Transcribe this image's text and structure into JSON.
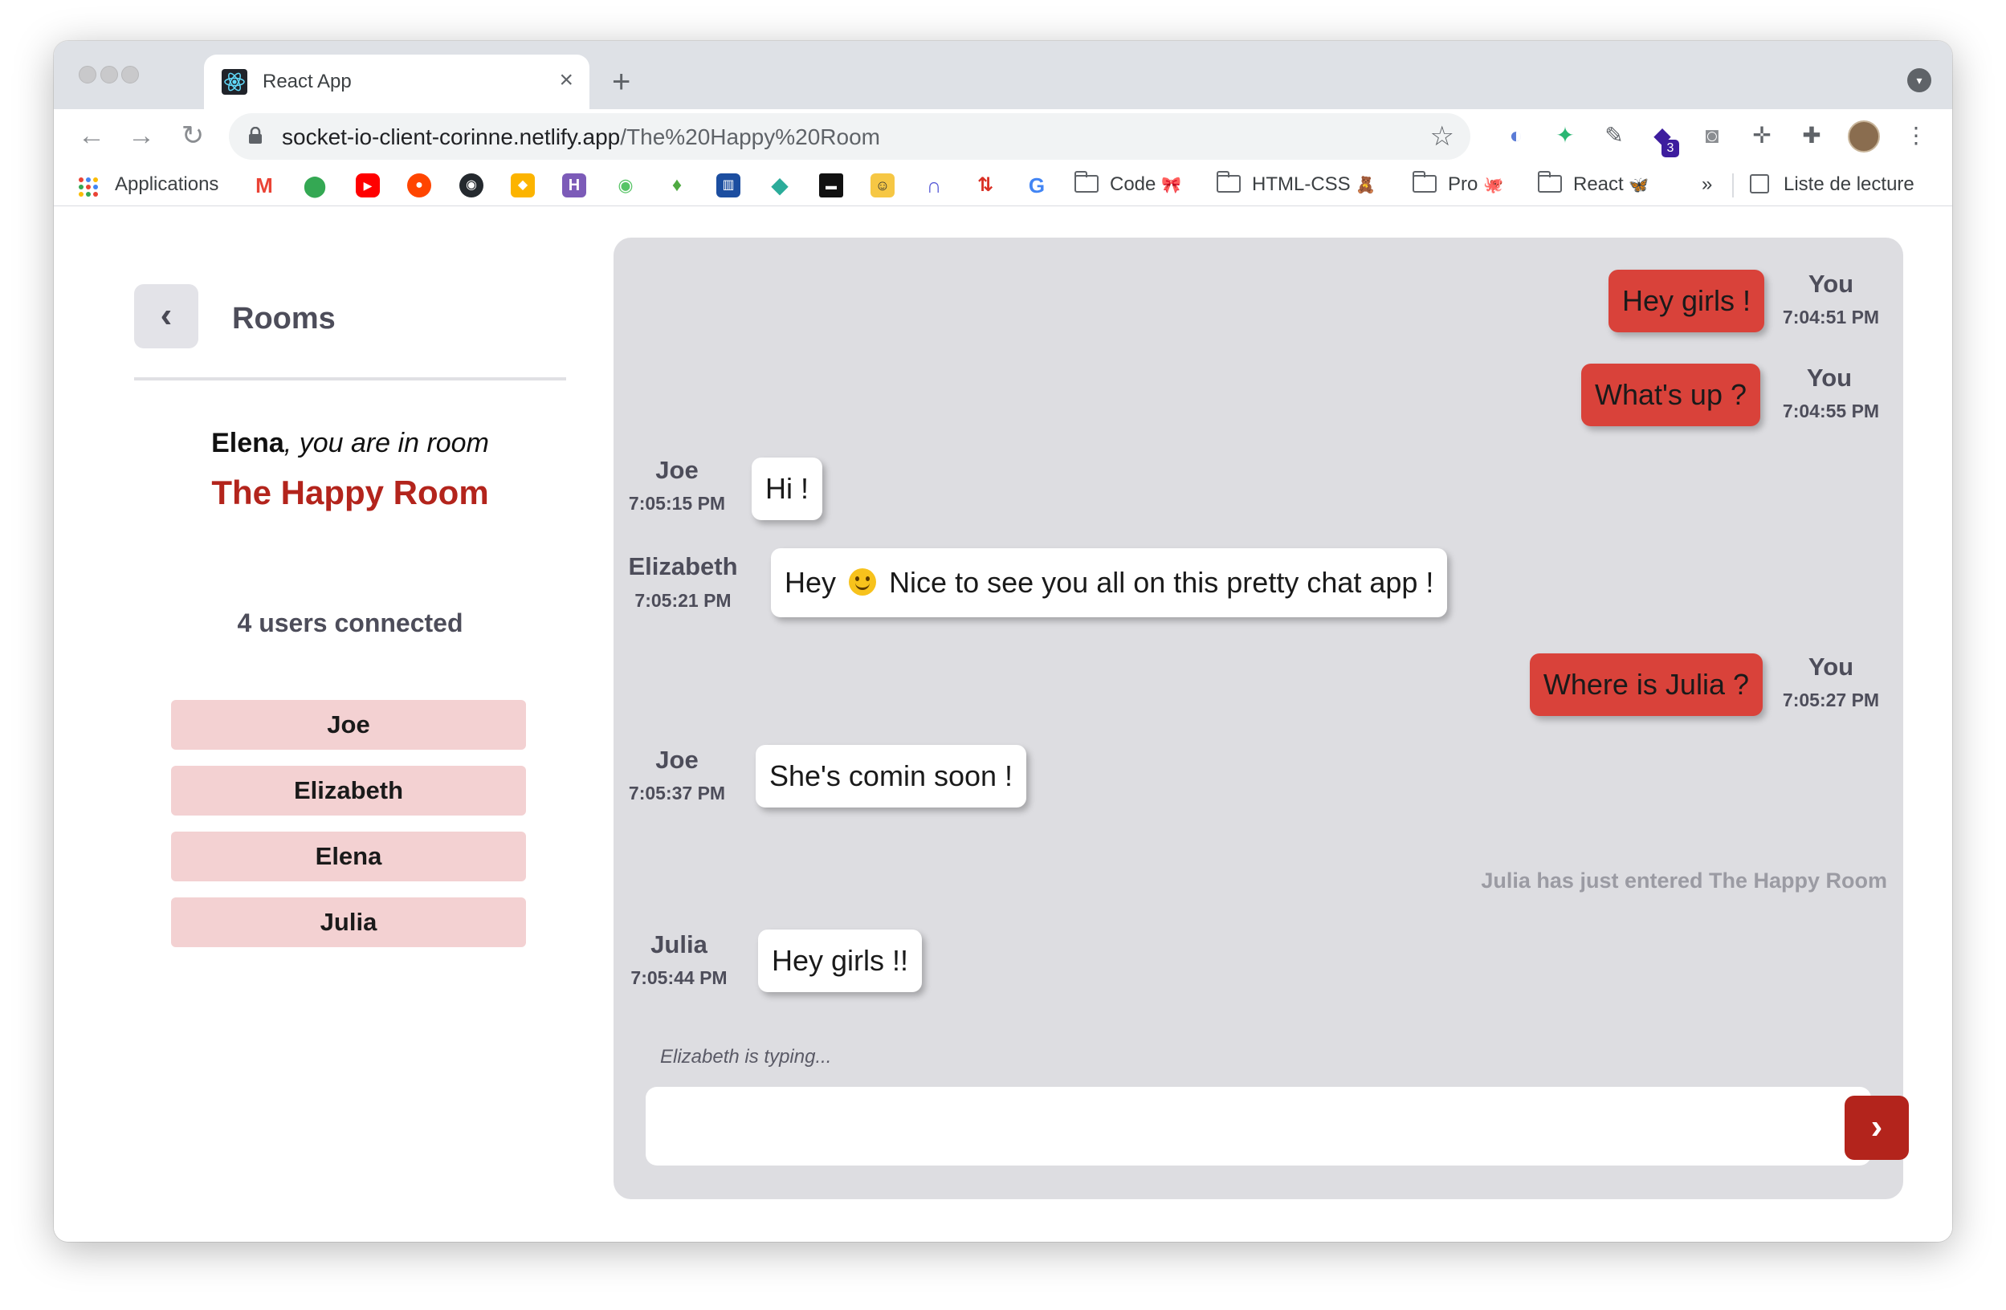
{
  "browser": {
    "tab_title": "React App",
    "tab_close": "×",
    "new_tab": "+",
    "url_host": "socket-io-client-corinne.netlify.app",
    "url_path": "/The%20Happy%20Room",
    "extension_badge": "3"
  },
  "bookmarks": {
    "apps_label": "Applications",
    "items": [
      {
        "label": "Code",
        "emoji": "🎀"
      },
      {
        "label": "HTML-CSS",
        "emoji": "🧸"
      },
      {
        "label": "Pro",
        "emoji": "🐙"
      },
      {
        "label": "React",
        "emoji": "🦋"
      }
    ],
    "overflow": "»",
    "reading_list": "Liste de lecture"
  },
  "sidebar": {
    "back_icon": "‹",
    "title": "Rooms",
    "user_name": "Elena",
    "greeting_suffix": ", you are in room",
    "room_name": "The Happy Room",
    "users_count": "4 users connected",
    "users": [
      "Joe",
      "Elizabeth",
      "Elena",
      "Julia"
    ]
  },
  "chat": {
    "messages": [
      {
        "sender": "You",
        "time": "7:04:51 PM",
        "text": "Hey girls !",
        "mine": true
      },
      {
        "sender": "You",
        "time": "7:04:55 PM",
        "text": "What's up ?",
        "mine": true
      },
      {
        "sender": "Joe",
        "time": "7:05:15 PM",
        "text": "Hi !",
        "mine": false
      },
      {
        "sender": "Elizabeth",
        "time": "7:05:21 PM",
        "text_before": "Hey",
        "text_after": "Nice to see you all on this pretty chat app !",
        "mine": false
      },
      {
        "sender": "You",
        "time": "7:05:27 PM",
        "text": "Where is Julia ?",
        "mine": true
      },
      {
        "sender": "Joe",
        "time": "7:05:37 PM",
        "text": "She's comin soon !",
        "mine": false
      },
      {
        "sender": "Julia",
        "time": "7:05:44 PM",
        "text": "Hey girls !!",
        "mine": false
      }
    ],
    "system_message": "Julia has just entered The Happy Room",
    "typing": "Elizabeth is typing...",
    "input_value": "",
    "send_icon": "›"
  },
  "colors": {
    "accent": "#b3241c",
    "my_bubble": "#d9423a",
    "user_pill": "#f3d1d2",
    "chat_bg": "#dddde1"
  }
}
